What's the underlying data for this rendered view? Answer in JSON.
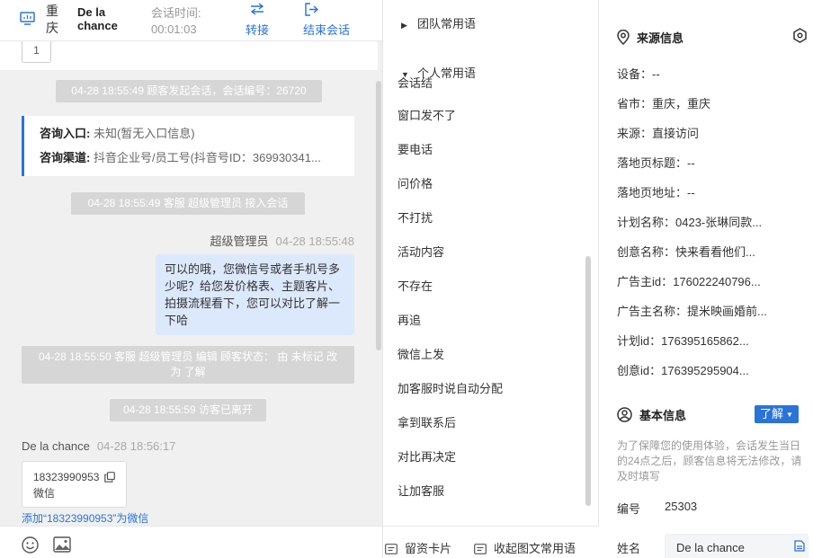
{
  "header": {
    "city": "重庆",
    "visitor_name": "De la chance",
    "session_time_label": "会话时间:",
    "session_time": "00:01:03",
    "transfer_label": "转接",
    "end_label": "结束会话"
  },
  "chat": {
    "page_number": "1",
    "sys_start": "04-28 18:55:49 顾客发起会话，会话编号：26720",
    "entry_label": "咨询入口:",
    "entry_value": "未知(暂无入口信息)",
    "channel_label": "咨询渠道:",
    "channel_value": "抖音企业号/员工号(抖音号ID：369930341...",
    "sys_join": "04-28 18:55:49 客服 超级管理员 接入会话",
    "agent_name": "超级管理员",
    "agent_time": "04-28 18:55:48",
    "agent_message": "可以的哦，您微信号或者手机号多少呢？给您发价格表、主题客片、拍摄流程看下，您可以对比了解一下哈",
    "sys_edit": "04-28 18:55:50 客服 超级管理员 编辑 顾客状态： 由 未标记 改为 了解",
    "sys_left": "04-28 18:55:59 访客已离开",
    "visitor_name": "De la chance",
    "visitor_time": "04-28 18:56:17",
    "phone_number": "18323990953",
    "phone_type": "微信",
    "add_wechat_link": "添加“18323990953”为微信"
  },
  "phrases": {
    "team_group": "团队常用语",
    "personal_group": "个人常用语",
    "items": [
      "会话结",
      "窗口发不了",
      "要电话",
      "问价格",
      "不打扰",
      "活动内容",
      "不存在",
      "再追",
      "微信上发",
      "加客服时说自动分配",
      "拿到联系后",
      "对比再决定",
      "让加客服"
    ],
    "footer_card": "留资卡片",
    "footer_collapse": "收起图文常用语"
  },
  "info": {
    "source_title": "来源信息",
    "device_label": "设备：",
    "device_value": "--",
    "province_label": "省市：",
    "province_value": "重庆，重庆",
    "source_label": "来源：",
    "source_value": "直接访问",
    "landing_title_label": "落地页标题：",
    "landing_title_value": "--",
    "landing_url_label": "落地页地址：",
    "landing_url_value": "--",
    "plan_name_label": "计划名称：",
    "plan_name_value": "0423-张琳同款...",
    "creative_name_label": "创意名称：",
    "creative_name_value": "快来看看他们...",
    "advertiser_id_label": "广告主id：",
    "advertiser_id_value": "176022240796...",
    "advertiser_name_label": "广告主名称：",
    "advertiser_name_value": "提米映画婚前...",
    "plan_id_label": "计划id：",
    "plan_id_value": "176395165862...",
    "creative_id_label": "创意id：",
    "creative_id_value": "176395295904...",
    "basic_title": "基本信息",
    "status_button": "了解",
    "notice": "为了保障您的使用体验，会话发生当日的24点之后，顾客信息将无法修改，请及时填写",
    "number_label": "编号",
    "number_value": "25303",
    "name_label": "姓名",
    "name_value": "De la chance"
  },
  "colors": {
    "accent": "#2a73d9",
    "bubble_agent": "#dce8fb",
    "system_msg": "#d6d6d6",
    "chat_bg": "#f0f0f0"
  }
}
